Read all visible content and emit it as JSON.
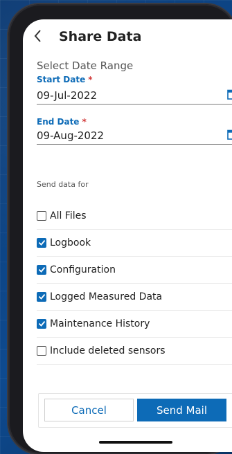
{
  "header": {
    "title": "Share Data"
  },
  "date_range": {
    "section_label": "Select Date Range",
    "start": {
      "label": "Start Date",
      "required_mark": "*",
      "value": "09-Jul-2022"
    },
    "end": {
      "label": "End Date",
      "required_mark": "*",
      "value": "09-Aug-2022"
    }
  },
  "send_for": {
    "label": "Send data for",
    "options": [
      {
        "label": "All Files",
        "checked": false
      },
      {
        "label": "Logbook",
        "checked": true
      },
      {
        "label": "Configuration",
        "checked": true
      },
      {
        "label": "Logged Measured Data",
        "checked": true
      },
      {
        "label": "Maintenance History",
        "checked": true
      },
      {
        "label": "Include deleted sensors",
        "checked": false
      }
    ]
  },
  "footer": {
    "cancel_label": "Cancel",
    "send_label": "Send Mail"
  },
  "colors": {
    "accent": "#0d6bb7",
    "required": "#d23b3b"
  },
  "icons": {
    "back": "chevron-left-icon",
    "calendar": "calendar-icon",
    "check": "checkmark-icon"
  }
}
